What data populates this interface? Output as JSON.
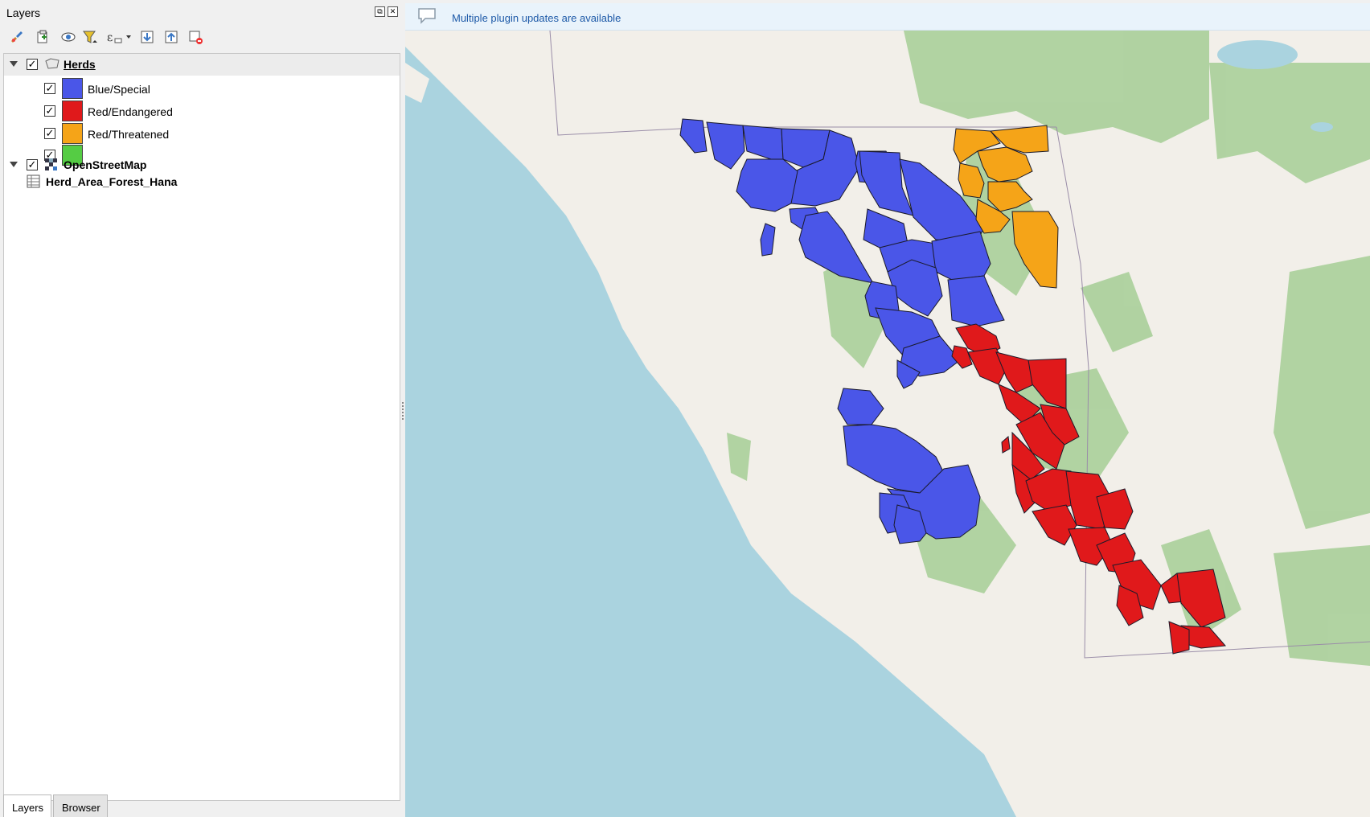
{
  "panel": {
    "title": "Layers",
    "float_button": "⧉",
    "close_button": "✕"
  },
  "toolbar": {
    "items": [
      {
        "icon": "paintbrush-icon"
      },
      {
        "icon": "add-group-icon"
      },
      {
        "icon": "eye-icon"
      },
      {
        "icon": "filter-icon"
      },
      {
        "icon": "expression-filter-icon"
      },
      {
        "icon": "expand-all-icon"
      },
      {
        "icon": "collapse-all-icon"
      },
      {
        "icon": "remove-layer-icon"
      }
    ]
  },
  "layers": {
    "herds": {
      "name": "Herds",
      "checked": "✓",
      "categories": [
        {
          "label": "Blue/Special",
          "color": "#4a56e8",
          "checked": "✓"
        },
        {
          "label": "Red/Endangered",
          "color": "#e0191b",
          "checked": "✓"
        },
        {
          "label": "Red/Threatened",
          "color": "#f5a418",
          "checked": "✓"
        },
        {
          "label": "",
          "color": "#55cc44",
          "checked": "✓"
        }
      ]
    },
    "osm": {
      "name": "OpenStreetMap",
      "checked": "✓"
    },
    "table": {
      "name": "Herd_Area_Forest_Hana"
    }
  },
  "tabs": {
    "layers": "Layers",
    "browser": "Browser"
  },
  "notification": {
    "text": "Multiple plugin updates are available"
  },
  "map": {
    "colors": {
      "water": "#aad3df",
      "land": "#f2efe9",
      "forest": "#add19e",
      "blue_special": "#4a56e8",
      "red_endangered": "#e0191b",
      "red_threatened": "#f5a418"
    }
  }
}
